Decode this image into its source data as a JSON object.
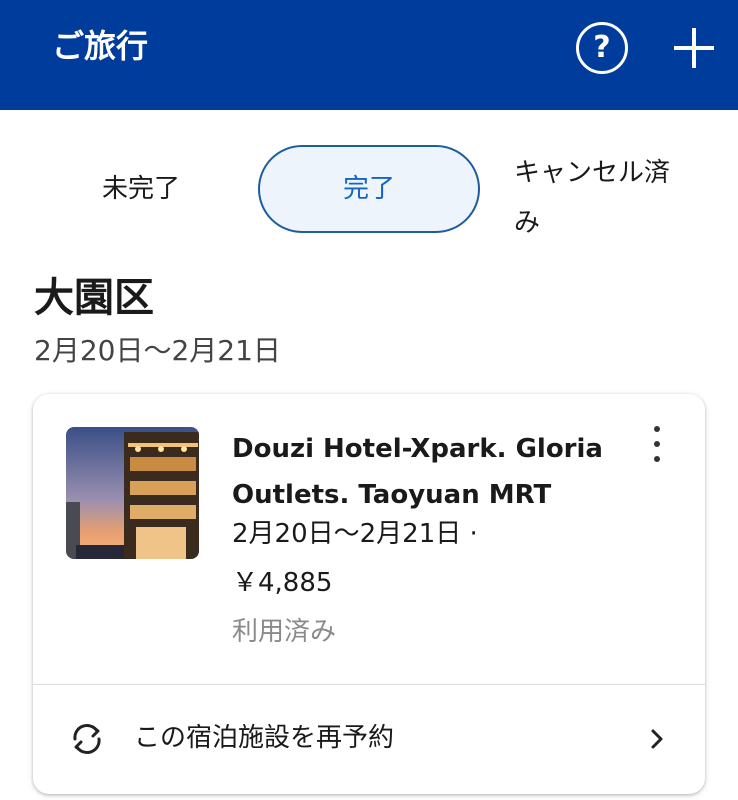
{
  "header": {
    "title": "ご旅行",
    "help_icon": "help-circle-icon",
    "add_icon": "plus-icon",
    "help_symbol": "?"
  },
  "tabs": [
    {
      "label": "未完了",
      "selected": false
    },
    {
      "label": "完了",
      "selected": true
    },
    {
      "label": "キャンセル済み",
      "selected": false
    }
  ],
  "trip": {
    "title": "大園区",
    "dates": "2月20日〜2月21日"
  },
  "booking": {
    "hotel_name": "Douzi Hotel-Xpark. Gloria Outlets. Taoyuan MRT",
    "stay_dates": "2月20日〜2月21日 ·",
    "price": "￥4,885",
    "status": "利用済み",
    "rebook_label": "この宿泊施設を再予約",
    "more_icon": "more-vertical-icon",
    "rebook_icon": "refresh-icon",
    "chevron_icon": "chevron-right-icon"
  },
  "colors": {
    "header_bg": "#003c9c",
    "tab_selected_border": "#1f5c9e",
    "tab_selected_text": "#1565c0",
    "tab_selected_bg": "#edf4fb",
    "status_text": "#8a8a8a"
  }
}
